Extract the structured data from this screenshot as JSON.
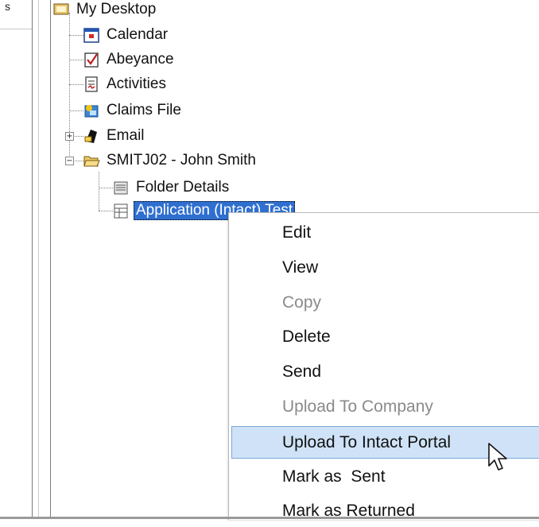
{
  "left_pane": {
    "column_label": "s"
  },
  "tree": {
    "items": [
      {
        "label": "My Desktop",
        "icon": "desktop-icon"
      },
      {
        "label": "Calendar",
        "icon": "calendar-icon"
      },
      {
        "label": "Abeyance",
        "icon": "checkbox-icon"
      },
      {
        "label": "Activities",
        "icon": "activities-icon"
      },
      {
        "label": "Claims File",
        "icon": "claims-file-icon"
      },
      {
        "label": "Email",
        "icon": "email-icon"
      },
      {
        "label": "SMITJ02 - John Smith",
        "icon": "open-folder-icon"
      },
      {
        "label": "Folder Details",
        "icon": "folder-details-icon"
      },
      {
        "label": "Application (Intact) Test",
        "icon": "application-form-icon"
      }
    ]
  },
  "context_menu": {
    "items": [
      {
        "label": "Edit",
        "disabled": false
      },
      {
        "label": "View",
        "disabled": false
      },
      {
        "label": "Copy",
        "disabled": true
      },
      {
        "label": "Delete",
        "disabled": false
      },
      {
        "label": "Send",
        "disabled": false
      },
      {
        "label": "Upload To Company",
        "disabled": true
      },
      {
        "label": "Upload To Intact Portal",
        "disabled": false,
        "highlighted": true
      },
      {
        "label": "Mark as  Sent",
        "disabled": false
      },
      {
        "label": "Mark as Returned",
        "disabled": false
      }
    ]
  },
  "colors": {
    "selection": "#2f6fd0",
    "menu_highlight": "#cfe2f7",
    "menu_highlight_border": "#7aa7dc"
  }
}
